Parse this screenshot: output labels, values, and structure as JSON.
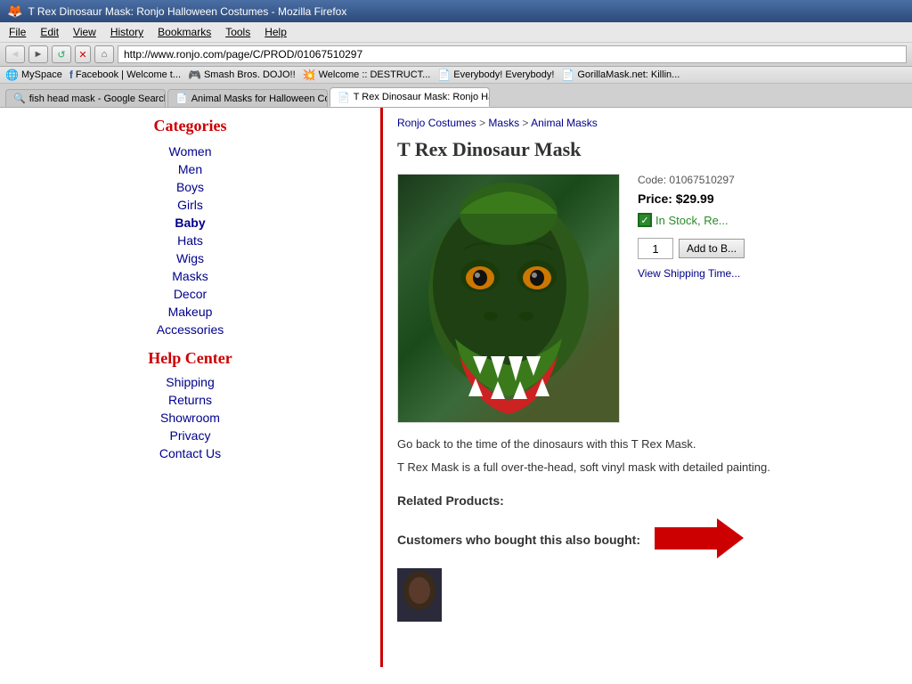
{
  "browser": {
    "title": "T Rex Dinosaur Mask: Ronjo Halloween Costumes - Mozilla Firefox",
    "back_label": "◄",
    "forward_label": "►",
    "refresh_label": "↺",
    "stop_label": "✕",
    "home_label": "⌂",
    "address": "http://www.ronjo.com/page/C/PROD/01067510297",
    "menus": [
      "File",
      "Edit",
      "View",
      "History",
      "Bookmarks",
      "Tools",
      "Help"
    ],
    "bookmarks": [
      {
        "icon": "🌐",
        "label": "MySpace"
      },
      {
        "icon": "f",
        "label": "Facebook | Welcome t..."
      },
      {
        "icon": "🎮",
        "label": "Smash Bros. DOJO!!"
      },
      {
        "icon": "💥",
        "label": "Welcome :: DESTRUCT..."
      },
      {
        "icon": "📄",
        "label": "Everybody! Everybody!"
      },
      {
        "icon": "📄",
        "label": "GorillaMask.net: Killin..."
      }
    ],
    "tabs": [
      {
        "label": "fish head mask - Google Search",
        "active": false,
        "closeable": false
      },
      {
        "label": "Animal Masks for Halloween Costu...",
        "active": false,
        "closeable": false
      },
      {
        "label": "T Rex Dinosaur Mask: Ronjo Hallo...",
        "active": true,
        "closeable": true
      }
    ]
  },
  "sidebar": {
    "categories_title": "Categories",
    "categories": [
      {
        "label": "Women",
        "bold": false
      },
      {
        "label": "Men",
        "bold": false
      },
      {
        "label": "Boys",
        "bold": false
      },
      {
        "label": "Girls",
        "bold": false
      },
      {
        "label": "Baby",
        "bold": true
      },
      {
        "label": "Hats",
        "bold": false
      },
      {
        "label": "Wigs",
        "bold": false
      },
      {
        "label": "Masks",
        "bold": false
      },
      {
        "label": "Decor",
        "bold": false
      },
      {
        "label": "Makeup",
        "bold": false
      },
      {
        "label": "Accessories",
        "bold": false
      }
    ],
    "help_title": "Help Center",
    "help_links": [
      {
        "label": "Shipping"
      },
      {
        "label": "Returns"
      },
      {
        "label": "Showroom"
      },
      {
        "label": "Privacy"
      },
      {
        "label": "Contact Us"
      }
    ]
  },
  "product": {
    "breadcrumb": {
      "store": "Ronjo Costumes",
      "separator1": " > ",
      "masks": "Masks",
      "separator2": " > ",
      "animal_masks": "Animal Masks"
    },
    "title": "T Rex Dinosaur Mask",
    "code_label": "Code: 01067510297",
    "price_label": "Price: $29.99",
    "in_stock_label": "In Stock, Re...",
    "qty_default": "1",
    "add_to_cart_label": "Add to B...",
    "shipping_label": "View Shipping Time...",
    "description_1": "Go back to the time of the dinosaurs with this T Rex Mask.",
    "description_2": "T Rex Mask is a full over-the-head, soft vinyl mask with detailed painting.",
    "related_products_label": "Related Products:",
    "customers_also_label": "Customers who bought this also bought:"
  }
}
